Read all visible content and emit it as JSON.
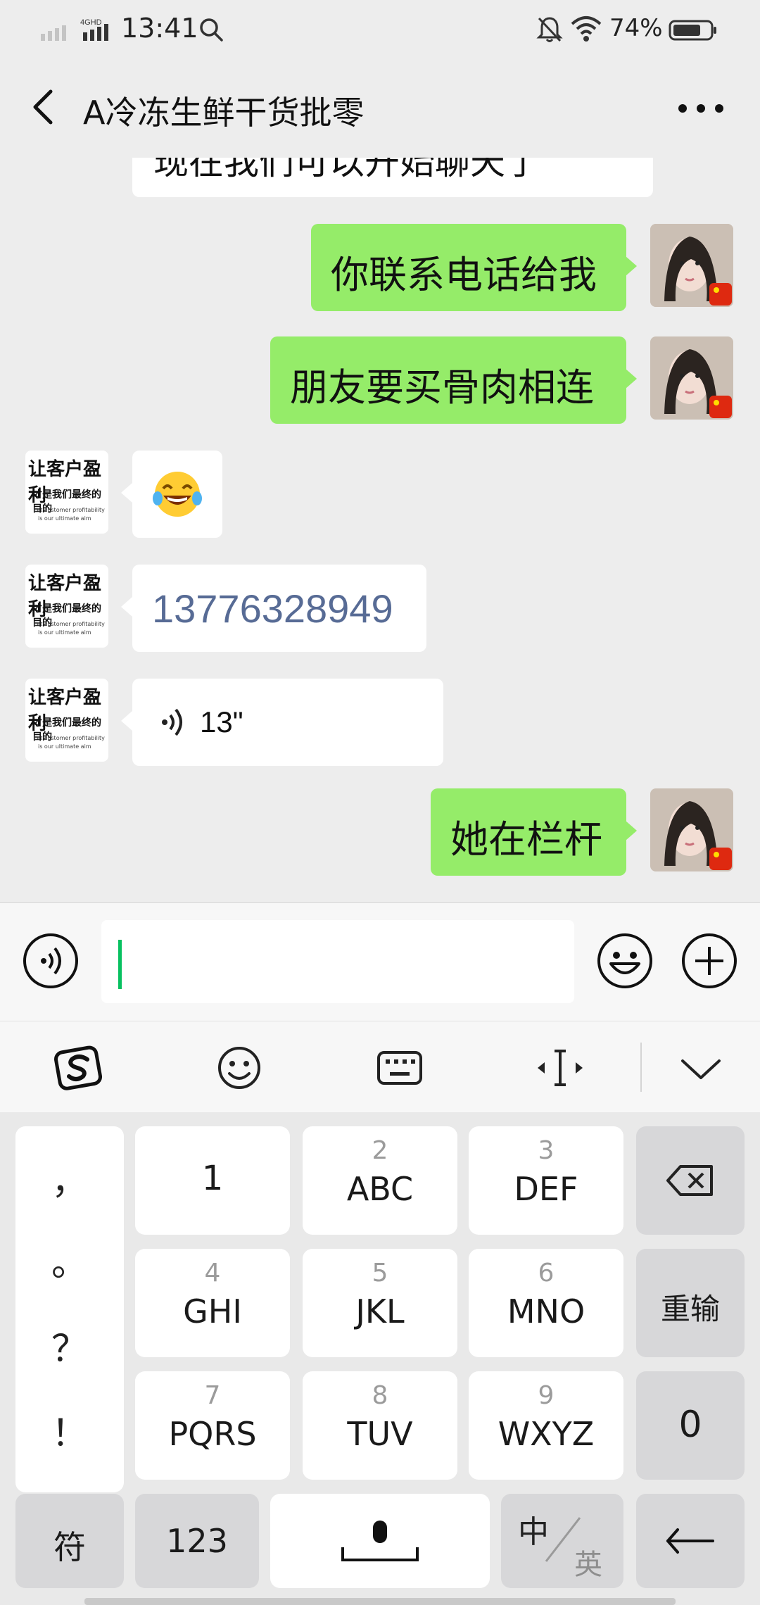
{
  "status_bar": {
    "network": "4GHD",
    "time": "13:41",
    "battery": "74%"
  },
  "header": {
    "title": "A冷冻生鲜干货批零"
  },
  "chat": {
    "top_partial_message": "现在我们可以开始聊天了",
    "messages": [
      {
        "side": "me",
        "type": "text",
        "text": "你联系电话给我"
      },
      {
        "side": "me",
        "type": "text",
        "text": "朋友要买骨肉相连"
      },
      {
        "side": "other",
        "type": "emoji",
        "emoji": "😂"
      },
      {
        "side": "other",
        "type": "text",
        "text": "13776328949"
      },
      {
        "side": "other",
        "type": "voice",
        "duration": "13\""
      },
      {
        "side": "me",
        "type": "text",
        "text": "她在栏杆"
      }
    ],
    "other_avatar_text": {
      "line1": "让客户盈利",
      "line2": "才是我们最终的目的",
      "line3": "Let customer profitability",
      "line4": "is our ultimate aim"
    }
  },
  "input": {
    "value": "",
    "placeholder": ""
  },
  "keyboard": {
    "punctuation": [
      "，",
      "。",
      "？",
      "！"
    ],
    "keys": [
      {
        "num": "",
        "letters": "1"
      },
      {
        "num": "2",
        "letters": "ABC"
      },
      {
        "num": "3",
        "letters": "DEF"
      },
      {
        "num": "4",
        "letters": "GHI"
      },
      {
        "num": "5",
        "letters": "JKL"
      },
      {
        "num": "6",
        "letters": "MNO"
      },
      {
        "num": "7",
        "letters": "PQRS"
      },
      {
        "num": "8",
        "letters": "TUV"
      },
      {
        "num": "9",
        "letters": "WXYZ"
      }
    ],
    "retype": "重输",
    "zero": "0",
    "symbols": "符",
    "numbers": "123",
    "lang_zh": "中",
    "lang_en": "英"
  },
  "colors": {
    "my_bubble": "#95ec69",
    "link_text": "#576b95",
    "caret": "#07c160"
  }
}
